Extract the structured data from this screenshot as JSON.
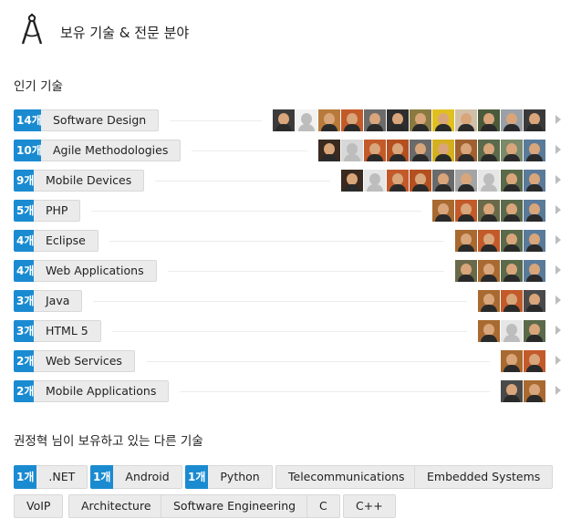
{
  "header": {
    "icon": "compass-drafting-icon",
    "title": "보유 기술 & 전문 분야"
  },
  "popular": {
    "title": "인기 기술",
    "skills": [
      {
        "count": "14개",
        "name": "Software Design",
        "avatars": [
          "#3b3b3b",
          "#f2f2f2",
          "#b87a3a",
          "#c35a2a",
          "#6b6b6b",
          "#2e2e2e",
          "#8a7a40",
          "#e0c020",
          "#d0c0a8",
          "#4a5a3a",
          "#9aa0a8",
          "#3a3a3a"
        ]
      },
      {
        "count": "10개",
        "name": "Agile Methodologies",
        "avatars": [
          "#3a2a20",
          "#d8d8d8",
          "#c35a2a",
          "#b45020",
          "#6a6a6a",
          "#d4b020",
          "#a06030",
          "#5a6a4a",
          "#7a8a6a",
          "#5a7a9a"
        ]
      },
      {
        "count": "9개",
        "name": "Mobile Devices",
        "avatars": [
          "#3a2a20",
          "#e6e6e6",
          "#c35a2a",
          "#b45020",
          "#6a6a6a",
          "#a4a4a4",
          "#e6e6e6",
          "#5a6a4a",
          "#5a7a9a"
        ]
      },
      {
        "count": "5개",
        "name": "PHP",
        "avatars": [
          "#a86a30",
          "#c35a2a",
          "#6a6a4a",
          "#5a6a4a",
          "#5a7a9a"
        ]
      },
      {
        "count": "4개",
        "name": "Eclipse",
        "avatars": [
          "#a86a30",
          "#c35a2a",
          "#5a6a4a",
          "#5a7a9a"
        ]
      },
      {
        "count": "4개",
        "name": "Web Applications",
        "avatars": [
          "#6a6a4a",
          "#a86a30",
          "#5a6a4a",
          "#5a7a9a"
        ]
      },
      {
        "count": "3개",
        "name": "Java",
        "avatars": [
          "#a86a30",
          "#c35a2a",
          "#4a4a4a"
        ]
      },
      {
        "count": "3개",
        "name": "HTML 5",
        "avatars": [
          "#a86a30",
          "#e6e6e6",
          "#5a6a4a"
        ]
      },
      {
        "count": "2개",
        "name": "Web Services",
        "avatars": [
          "#a86a30",
          "#c35a2a"
        ]
      },
      {
        "count": "2개",
        "name": "Mobile Applications",
        "avatars": [
          "#4a4a4a",
          "#a86a30"
        ]
      }
    ]
  },
  "other": {
    "title": "권정혁 님이 보유하고 있는 다른 기술",
    "tags": [
      {
        "count": "1개",
        "name": ".NET"
      },
      {
        "count": "1개",
        "name": "Android"
      },
      {
        "count": "1개",
        "name": "Python"
      },
      {
        "count": "",
        "name": "Telecommunications"
      },
      {
        "count": "",
        "name": "Embedded Systems"
      },
      {
        "count": "",
        "name": "VoIP"
      },
      {
        "count": "",
        "name": "Architecture"
      },
      {
        "count": "",
        "name": "Software Engineering"
      },
      {
        "count": "",
        "name": "C"
      },
      {
        "count": "",
        "name": "C++"
      }
    ]
  },
  "colors": {
    "badge": "#1a8bd1",
    "tag_bg": "#ebebeb"
  }
}
